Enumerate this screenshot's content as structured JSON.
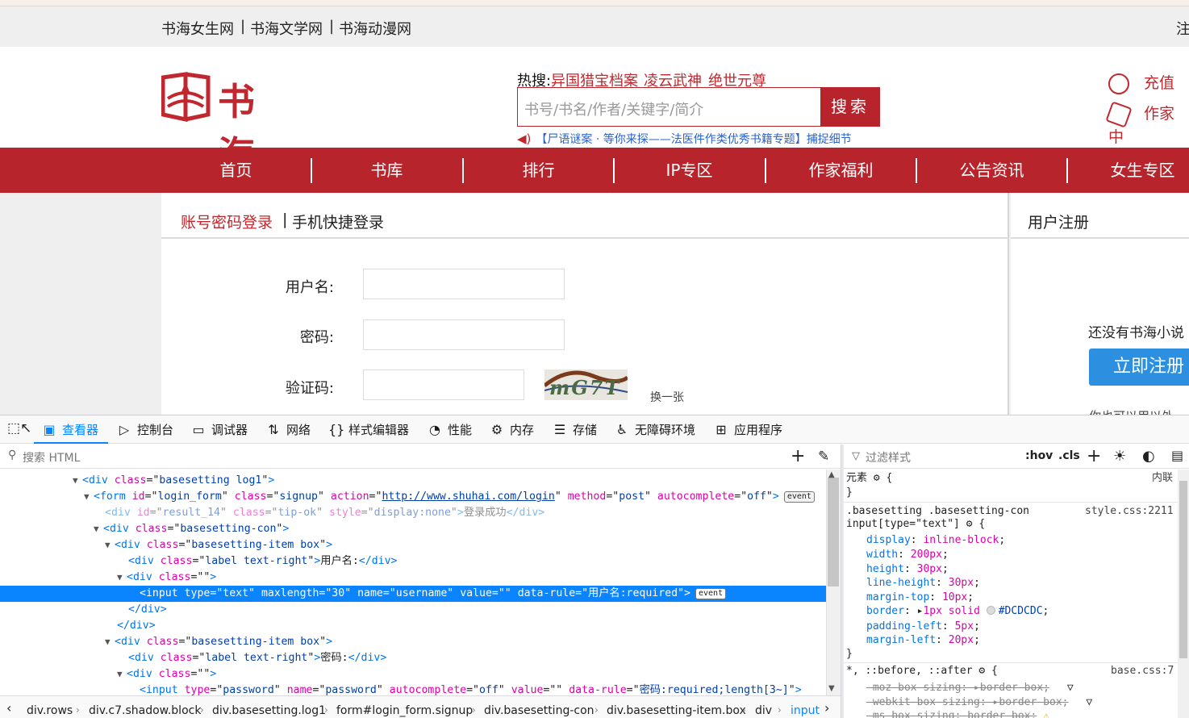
{
  "site": {
    "top_links": [
      "书海女生网",
      "书海文学网",
      "书海动漫网"
    ],
    "top_separator": "|",
    "top_right": "注",
    "logo_text": "书海",
    "hot_label": "热搜:",
    "hot_items": [
      "异国猎宝档案",
      "凌云武神",
      "绝世元尊"
    ],
    "search_placeholder": "书号/书名/作者/关键字/简介",
    "search_button": "搜索",
    "notice": "【尸语谜案 · 等你来探——法医件作类优秀书籍专题】捕捉细节",
    "side_links": [
      "充值",
      "作家中"
    ],
    "nav": [
      "首页",
      "书库",
      "排行",
      "IP专区",
      "作家福利",
      "公告资讯",
      "女生专区"
    ],
    "login": {
      "tab_account": "账号密码登录",
      "tab_sep": "|",
      "tab_phone": "手机快捷登录",
      "username_label": "用户名:",
      "password_label": "密码:",
      "captcha_label": "验证码:",
      "captcha_text": "mG7T",
      "captcha_refresh": "换一张"
    },
    "register": {
      "title": "用户注册",
      "text": "还没有书海小说",
      "button": "立即注册",
      "more": "你也可以用以外"
    }
  },
  "devtools": {
    "tabs": [
      "查看器",
      "控制台",
      "调试器",
      "网络",
      "样式编辑器",
      "性能",
      "内存",
      "存储",
      "无障碍环境",
      "应用程序"
    ],
    "tab_icons": [
      "inspector-icon",
      "console-icon",
      "debugger-icon",
      "network-icon",
      "style-editor-icon",
      "performance-icon",
      "memory-icon",
      "storage-icon",
      "accessibility-icon",
      "application-icon"
    ],
    "active_tab": "查看器",
    "search_placeholder": "搜索 HTML",
    "markup": {
      "l1": {
        "tag": "div",
        "attr": "class",
        "val": "basesetting log1"
      },
      "l2": {
        "tag": "form",
        "a1": "id",
        "v1": "login_form",
        "a2": "class",
        "v2": "signup",
        "a3": "action",
        "v3": "http://www.shuhai.com/login",
        "a4": "method",
        "v4": "post",
        "a5": "autocomplete",
        "v5": "off",
        "badge": "event"
      },
      "l3": {
        "tag": "div",
        "a1": "id",
        "v1": "result_14",
        "a2": "class",
        "v2": "tip-ok",
        "a3": "style",
        "v3": "display:none",
        "text": "登录成功"
      },
      "l4": {
        "tag": "div",
        "attr": "class",
        "val": "basesetting-con"
      },
      "l5": {
        "tag": "div",
        "attr": "class",
        "val": "basesetting-item box"
      },
      "l6": {
        "tag": "div",
        "attr": "class",
        "val": "label text-right",
        "text": "用户名:"
      },
      "l7": {
        "tag": "div",
        "attr": "class",
        "val": ""
      },
      "l8": {
        "tag": "input",
        "a1": "type",
        "v1": "text",
        "a2": "maxlength",
        "v2": "30",
        "a3": "name",
        "v3": "username",
        "a4": "value",
        "v4": "",
        "a5": "data-rule",
        "v5": "用户名:required",
        "badge": "event"
      },
      "l9": {
        "close": "div"
      },
      "l10": {
        "close": "div"
      },
      "l11": {
        "tag": "div",
        "attr": "class",
        "val": "basesetting-item box"
      },
      "l12": {
        "tag": "div",
        "attr": "class",
        "val": "label text-right",
        "text": "密码:"
      },
      "l13": {
        "tag": "div",
        "attr": "class",
        "val": ""
      },
      "l14": {
        "tag": "input",
        "a1": "type",
        "v1": "password",
        "a2": "name",
        "v2": "password",
        "a3": "autocomplete",
        "v3": "off",
        "a4": "value",
        "v4": "",
        "a5": "data-rule",
        "v5": "密码:required;length[3~]"
      }
    },
    "breadcrumbs": [
      "div.rows",
      "div.c7.shadow.block",
      "div.basesetting.log1",
      "form#login_form.signup",
      "div.basesetting-con",
      "div.basesetting-item.box",
      "div",
      "input"
    ],
    "rules_filter_placeholder": "过滤样式",
    "hov": ":hov",
    "cls": ".cls",
    "rules": {
      "element_label": "元素",
      "element_source": "内联",
      "rule1_selector_a": ".basesetting .basesetting-con",
      "rule1_selector_b": "input[type=\"text\"]",
      "rule1_source": "style.css:2211",
      "rule1_props": [
        {
          "name": "display",
          "value": "inline-block"
        },
        {
          "name": "width",
          "value": "200px"
        },
        {
          "name": "height",
          "value": "30px"
        },
        {
          "name": "line-height",
          "value": "30px"
        },
        {
          "name": "margin-top",
          "value": "10px"
        },
        {
          "name": "border",
          "value": "1px solid",
          "color": "#DCDCDC"
        },
        {
          "name": "padding-left",
          "value": "5px"
        },
        {
          "name": "margin-left",
          "value": "20px"
        }
      ],
      "rule2_selector": "*, ::before, ::after",
      "rule2_source": "base.css:7",
      "rule2_props": [
        {
          "name": "-moz-box-sizing",
          "value": "border-box"
        },
        {
          "name": "-webkit-box-sizing",
          "value": "border-box"
        },
        {
          "name": "-ms-box-sizing",
          "value": "border-box"
        }
      ]
    }
  },
  "colors": {
    "brand_red": "#b8242c",
    "link_red": "#c0272e",
    "devtools_accent": "#0a84ff",
    "register_blue": "#2d8fe0"
  }
}
